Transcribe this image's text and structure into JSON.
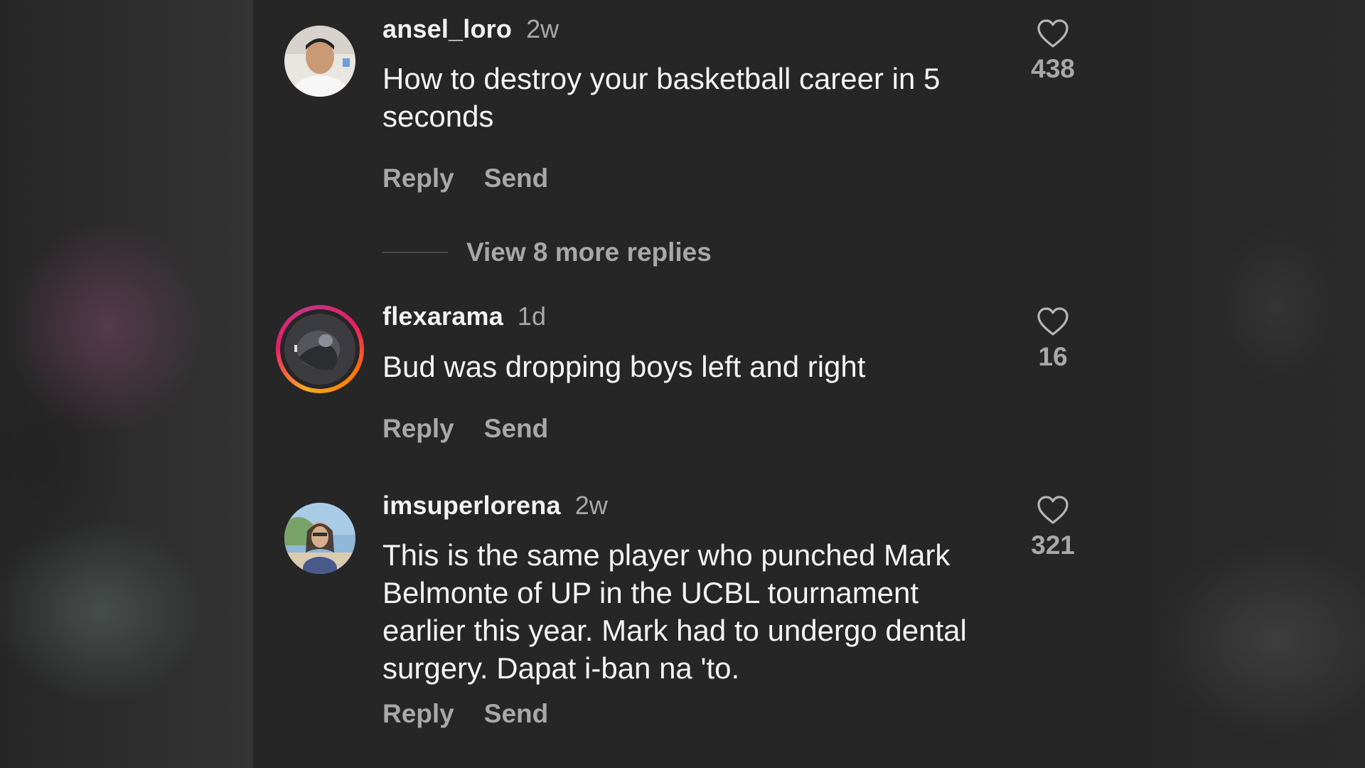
{
  "comments": [
    {
      "username": "ansel_loro",
      "time": "2w",
      "text": "How to destroy your basketball career in 5 seconds",
      "likes": "438",
      "reply_label": "Reply",
      "send_label": "Send"
    },
    {
      "username": "flexarama",
      "time": "1d",
      "text": "Bud was dropping boys left and right",
      "likes": "16",
      "reply_label": "Reply",
      "send_label": "Send",
      "has_story_ring": true
    },
    {
      "username": "imsuperlorena",
      "time": "2w",
      "text": "This is the same player who punched Mark Belmonte of UP in the UCBL tournament earlier this year. Mark had to undergo dental surgery. Dapat i-ban na 'to.",
      "likes": "321",
      "reply_label": "Reply",
      "send_label": "Send"
    }
  ],
  "view_more_replies": "View 8 more replies",
  "icons": {
    "like": "heart-outline-icon"
  },
  "colors": {
    "panel_bg": "#262626",
    "primary_text": "#f4f4f4",
    "secondary_text": "#a8a8a8",
    "story_ring": [
      "#f9a825",
      "#e91e63",
      "#c13584"
    ]
  }
}
